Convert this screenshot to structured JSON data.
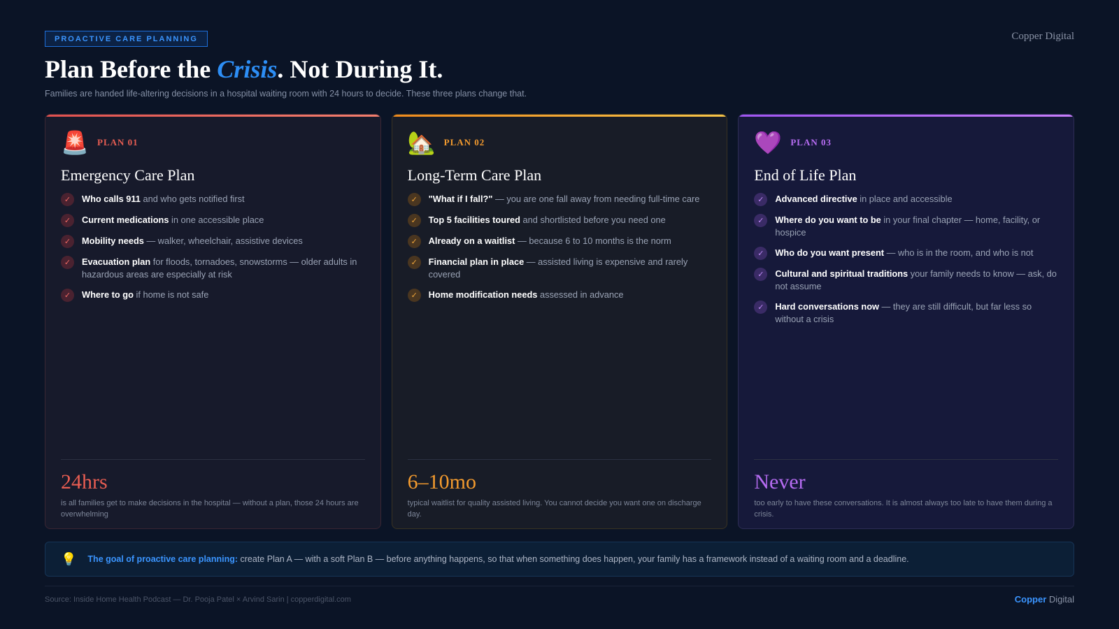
{
  "header": {
    "tag": "PROACTIVE CARE PLANNING",
    "brand": "Copper Digital",
    "title_pre": "Plan Before the ",
    "title_accent": "Crisis",
    "title_post": ". Not During It.",
    "subtitle": "Families are handed life-altering decisions in a hospital waiting room with 24 hours to decide. These three plans change that."
  },
  "colors": {
    "background": "#0b1426",
    "accent_blue": "#2d8ef5",
    "plan1": "#e85d52",
    "plan2": "#f29a2e",
    "plan3": "#b66cf2"
  },
  "cards": [
    {
      "icon": "🚨",
      "icon_name": "police-light-icon",
      "plan_label": "PLAN 01",
      "title": "Emergency Care Plan",
      "items": [
        {
          "bold": "Who calls 911",
          "rest": " and who gets notified first"
        },
        {
          "bold": "Current medications",
          "rest": " in one accessible place"
        },
        {
          "bold": "Mobility needs",
          "rest": " — walker, wheelchair, assistive devices"
        },
        {
          "bold": "Evacuation plan",
          "rest": " for floods, tornadoes, snowstorms — older adults in hazardous areas are especially at risk"
        },
        {
          "bold": "Where to go",
          "rest": " if home is not safe"
        }
      ],
      "stat": "24hrs",
      "stat_desc": "is all families get to make decisions in the hospital — without a plan, those 24 hours are overwhelming"
    },
    {
      "icon": "🏡",
      "icon_name": "house-icon",
      "plan_label": "PLAN 02",
      "title": "Long-Term Care Plan",
      "items": [
        {
          "bold": "\"What if I fall?\"",
          "rest": " — you are one fall away from needing full-time care"
        },
        {
          "bold": "Top 5 facilities toured",
          "rest": " and shortlisted before you need one"
        },
        {
          "bold": "Already on a waitlist",
          "rest": " — because 6 to 10 months is the norm"
        },
        {
          "bold": "Financial plan in place",
          "rest": " — assisted living is expensive and rarely covered"
        },
        {
          "bold": "Home modification needs",
          "rest": " assessed in advance"
        }
      ],
      "stat": "6–10mo",
      "stat_desc": "typical waitlist for quality assisted living. You cannot decide you want one on discharge day."
    },
    {
      "icon": "💜",
      "icon_name": "purple-heart-icon",
      "plan_label": "PLAN 03",
      "title": "End of Life Plan",
      "items": [
        {
          "bold": "Advanced directive",
          "rest": " in place and accessible"
        },
        {
          "bold": "Where do you want to be",
          "rest": " in your final chapter — home, facility, or hospice"
        },
        {
          "bold": "Who do you want present",
          "rest": " — who is in the room, and who is not"
        },
        {
          "bold": "Cultural and spiritual traditions",
          "rest": " your family needs to know — ask, do not assume"
        },
        {
          "bold": "Hard conversations now",
          "rest": " — they are still difficult, but far less so without a crisis"
        }
      ],
      "stat": "Never",
      "stat_desc": "too early to have these conversations. It is almost always too late to have them during a crisis."
    }
  ],
  "callout": {
    "icon": "💡",
    "icon_name": "lightbulb-icon",
    "bold": "The goal of proactive care planning:",
    "rest": " create Plan A — with a soft Plan B — before anything happens, so that when something does happen, your family has a framework instead of a waiting room and a deadline."
  },
  "footer": {
    "source": "Source: Inside Home Health Podcast — Dr. Pooja Patel × Arvind Sarin | copperdigital.com",
    "brand_1": "Copper",
    "brand_2": " Digital"
  }
}
